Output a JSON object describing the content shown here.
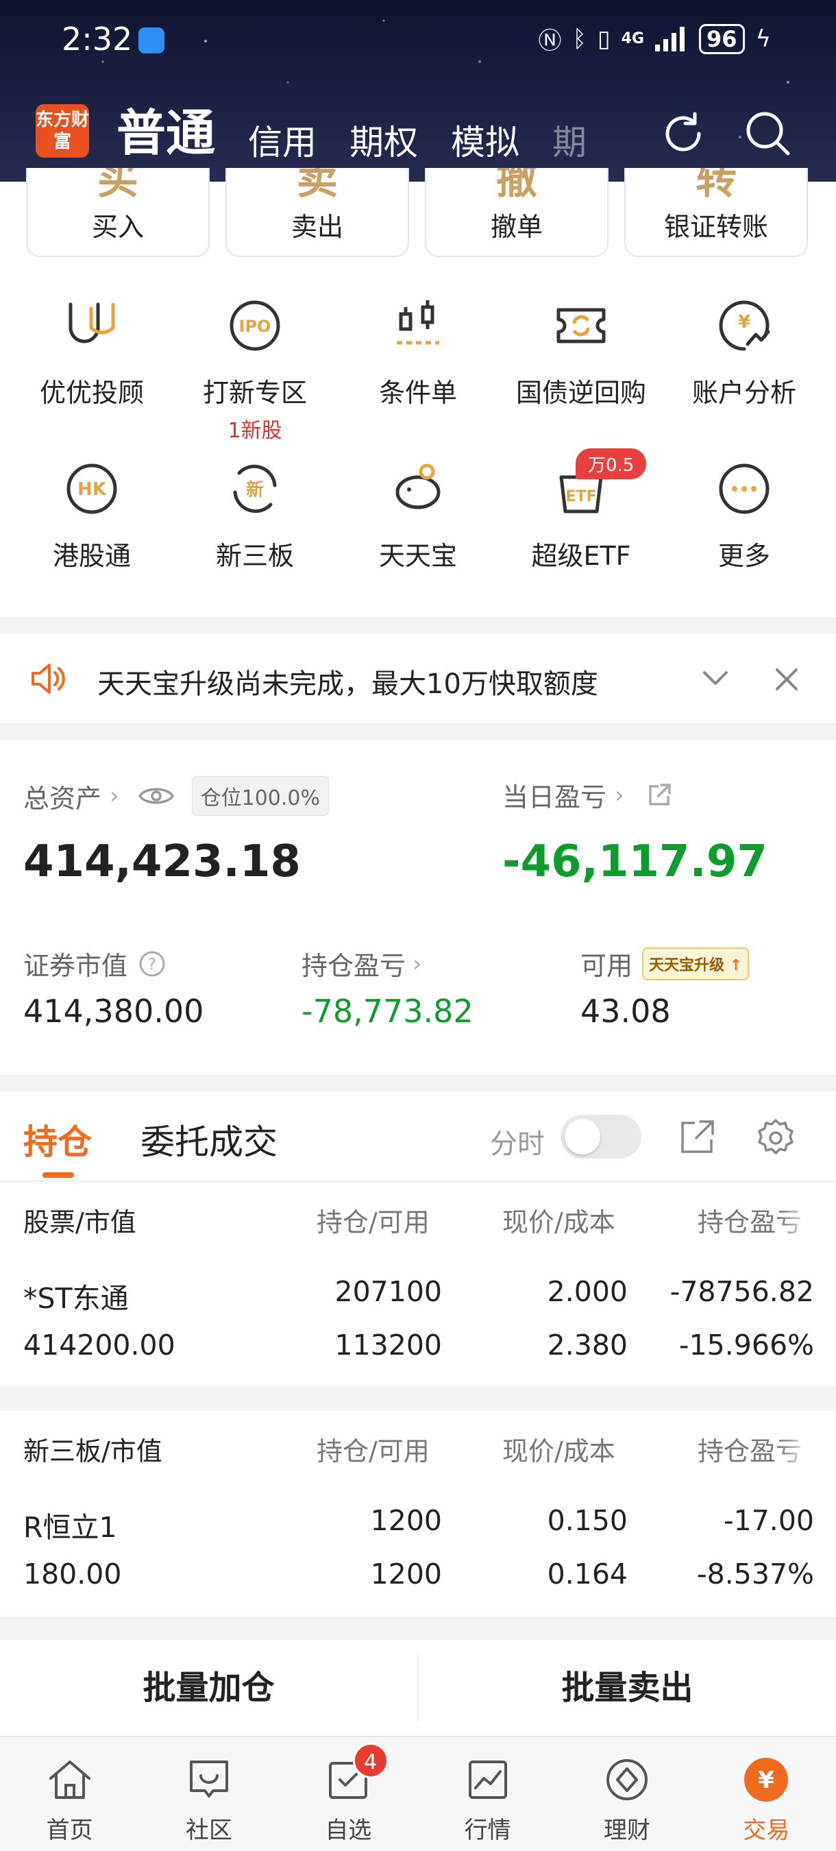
{
  "status": {
    "time": "2:32",
    "network": "4G",
    "battery": "96"
  },
  "header": {
    "logo": "东方财富",
    "tabs": [
      {
        "label": "普通"
      },
      {
        "label": "信用"
      },
      {
        "label": "期权"
      },
      {
        "label": "模拟"
      },
      {
        "label": "期"
      }
    ]
  },
  "actions": [
    {
      "big": "买",
      "label": "买入"
    },
    {
      "big": "卖",
      "label": "卖出"
    },
    {
      "big": "撤",
      "label": "撤单"
    },
    {
      "big": "转",
      "label": "银证转账"
    }
  ],
  "grid": [
    {
      "label": "优优投顾",
      "sub": ""
    },
    {
      "label": "打新专区",
      "sub": "1新股"
    },
    {
      "label": "条件单",
      "sub": ""
    },
    {
      "label": "国债逆回购",
      "sub": ""
    },
    {
      "label": "账户分析",
      "sub": ""
    },
    {
      "label": "港股通",
      "sub": "",
      "icon_text": "HK"
    },
    {
      "label": "新三板",
      "sub": "",
      "icon_text": "新"
    },
    {
      "label": "天天宝",
      "sub": ""
    },
    {
      "label": "超级ETF",
      "sub": "",
      "icon_text": "ETF"
    },
    {
      "label": "更多",
      "sub": ""
    }
  ],
  "ipo_icon_text": "IPO",
  "yuan_symbol": "¥",
  "etf_badge": "万0.5",
  "notice": {
    "text": "天天宝升级尚未完成，最大10万快取额度"
  },
  "assets": {
    "total_label": "总资产",
    "position_chip": "仓位100.0%",
    "total_value": "414,423.18",
    "daily_label": "当日盈亏",
    "daily_value": "-46,117.97",
    "market_label": "证券市值",
    "market_value": "414,380.00",
    "holding_pl_label": "持仓盈亏",
    "holding_pl_value": "-78,773.82",
    "available_label": "可用",
    "upgrade_tag": "天天宝升级",
    "available_value": "43.08"
  },
  "positions": {
    "tab_active": "持仓",
    "tab_other": "委托成交",
    "fenshi": "分时",
    "columns": [
      "股票/市值",
      "持仓/可用",
      "现价/成本",
      "持仓盈亏"
    ],
    "rows": [
      {
        "name": "*ST东通",
        "market_value": "414200.00",
        "hold": "207100",
        "avail": "113200",
        "price": "2.000",
        "cost": "2.380",
        "pl": "-78756.82",
        "pl_pct": "-15.966%"
      }
    ]
  },
  "neeq": {
    "columns": [
      "新三板/市值",
      "持仓/可用",
      "现价/成本",
      "持仓盈亏"
    ],
    "rows": [
      {
        "name": "R恒立1",
        "market_value": "180.00",
        "hold": "1200",
        "avail": "1200",
        "price": "0.150",
        "cost": "0.164",
        "pl": "-17.00",
        "pl_pct": "-8.537%"
      }
    ]
  },
  "batch": {
    "add": "批量加仓",
    "sell": "批量卖出"
  },
  "nav": [
    {
      "label": "首页"
    },
    {
      "label": "社区"
    },
    {
      "label": "自选",
      "badge": "4"
    },
    {
      "label": "行情"
    },
    {
      "label": "理财"
    },
    {
      "label": "交易"
    }
  ],
  "colors": {
    "accent": "#ef6b1f",
    "loss_green": "#0e9c2a",
    "gold": "#caa160",
    "badge_red": "#ea3b2e"
  }
}
